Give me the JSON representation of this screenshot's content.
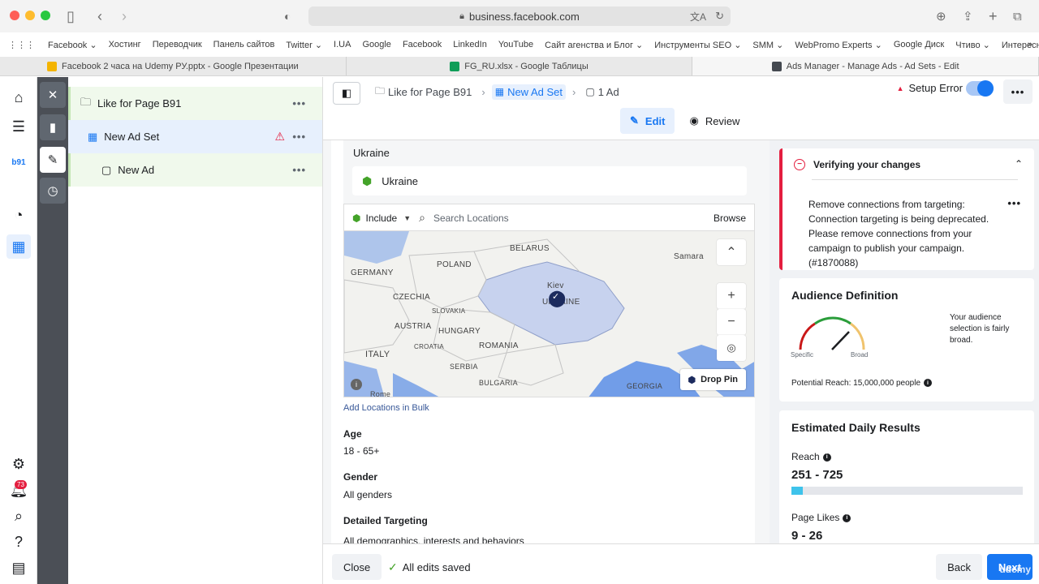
{
  "browser": {
    "url": "business.facebook.com",
    "bookmarks": [
      "Facebook ⌄",
      "Хостинг",
      "Переводчик",
      "Панель сайтов",
      "Twitter ⌄",
      "I.UA",
      "Google",
      "Facebook",
      "LinkedIn",
      "YouTube",
      "Сайт агенства и Блог ⌄",
      "Инструменты SEO ⌄",
      "SMM ⌄",
      "WebPromo Experts ⌄",
      "Google Диск",
      "Чтиво ⌄",
      "Интересное ⌄"
    ],
    "tabs": [
      {
        "label": "Facebook 2 часа на Udemy РУ.pptx - Google Презентации",
        "color": "#f4b400"
      },
      {
        "label": "FG_RU.xlsx - Google Таблицы",
        "color": "#0f9d58"
      },
      {
        "label": "Ads Manager - Manage Ads - Ad Sets - Edit",
        "color": "#444950"
      }
    ]
  },
  "left_nav": {
    "notification_count": "73"
  },
  "tree": {
    "campaign": "Like for Page B91",
    "adset": "New Ad Set",
    "ad": "New Ad"
  },
  "header": {
    "crumb_campaign": "Like for Page B91",
    "crumb_adset": "New Ad Set",
    "crumb_ad": "1 Ad",
    "setup_error": "Setup Error",
    "edit_tab": "Edit",
    "review_tab": "Review"
  },
  "locations": {
    "group_title": "Ukraine",
    "chip": "Ukraine",
    "include_label": "Include",
    "search_placeholder": "Search Locations",
    "browse": "Browse",
    "map_labels": [
      "GERMANY",
      "POLAND",
      "BELARUS",
      "Samara",
      "CZECHIA",
      "SLOVAKIA",
      "AUSTRIA",
      "HUNGARY",
      "Kiev",
      "UKRAINE",
      "ITALY",
      "CROATIA",
      "ROMANIA",
      "SERBIA",
      "BULGARIA",
      "GEORGIA",
      "Rome"
    ],
    "drop_pin": "Drop Pin",
    "add_bulk": "Add Locations in Bulk"
  },
  "targeting": {
    "age_label": "Age",
    "age_value": "18 - 65+",
    "gender_label": "Gender",
    "gender_value": "All genders",
    "detailed_label": "Detailed Targeting",
    "detailed_value": "All demographics, interests and behaviors"
  },
  "verify": {
    "title": "Verifying your changes",
    "message": "Remove connections from targeting: Connection targeting is being deprecated. Please remove connections from your campaign to publish your campaign. (#1870088)"
  },
  "audience": {
    "title": "Audience Definition",
    "specific": "Specific",
    "broad": "Broad",
    "description": "Your audience selection is fairly broad.",
    "potential_reach": "Potential Reach: 15,000,000 people"
  },
  "estimates": {
    "title": "Estimated Daily Results",
    "reach_label": "Reach",
    "reach_value": "251 - 725",
    "reach_fill": 0.05,
    "likes_label": "Page Likes",
    "likes_value": "9 - 26"
  },
  "footer": {
    "close": "Close",
    "saved": "All edits saved",
    "back": "Back",
    "next": "Next",
    "watermark": "udemy"
  },
  "colors": {
    "accent": "#1877f2",
    "error": "#e41e3f",
    "success": "#44a329"
  }
}
